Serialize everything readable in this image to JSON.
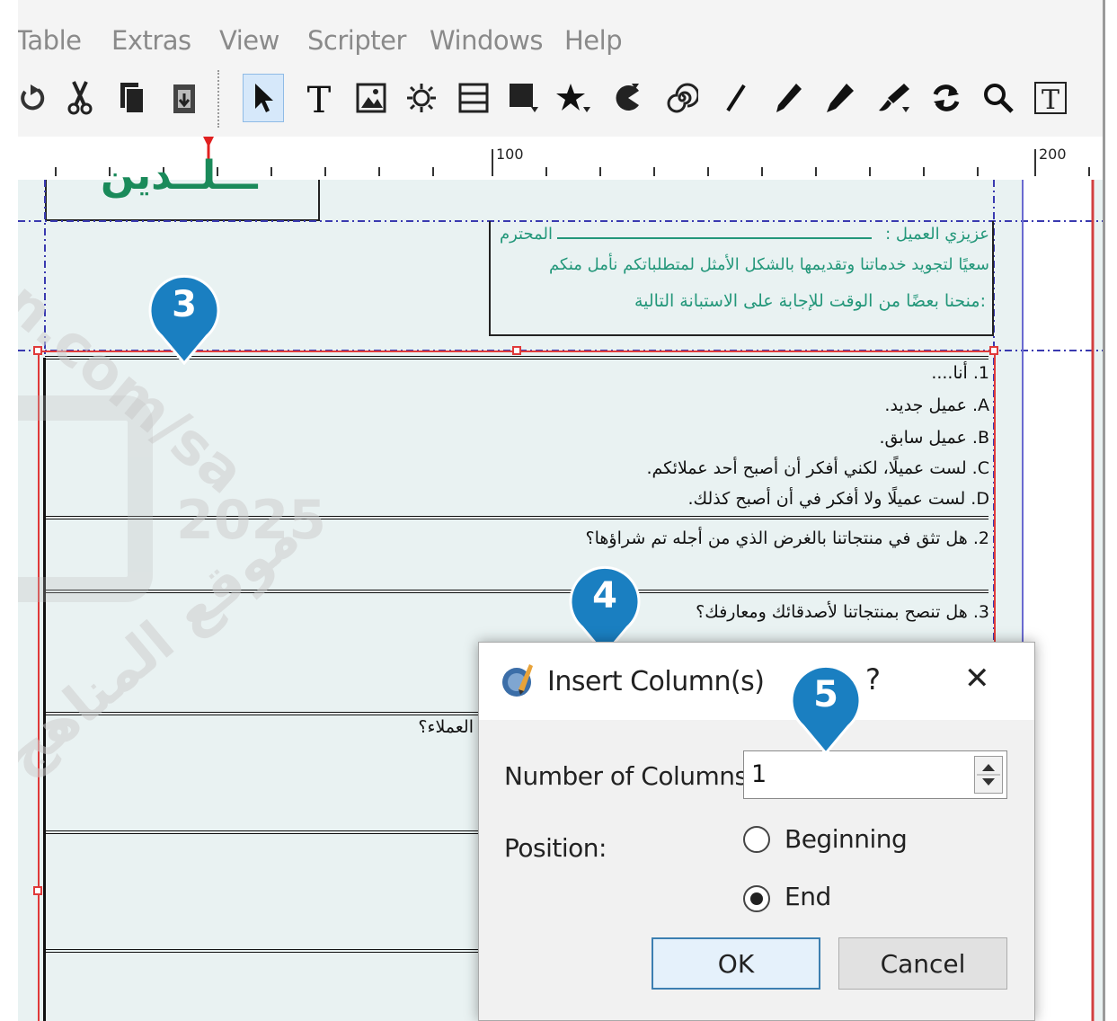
{
  "menu": [
    "Table",
    "Extras",
    "View",
    "Scripter",
    "Windows",
    "Help"
  ],
  "toolbar_icons": [
    "undo-icon",
    "cut-icon",
    "copy-icon",
    "paste-icon",
    "select-icon",
    "text-frame-icon",
    "image-frame-icon",
    "render-frame-icon",
    "table-icon",
    "shape-icon",
    "polygon-icon",
    "arc-icon",
    "spiral-icon",
    "line-icon",
    "bezier-icon",
    "freehand-icon",
    "calligraphic-icon",
    "rotate-icon",
    "zoom-icon",
    "edit-text-icon"
  ],
  "ruler": {
    "marks": [
      "100",
      "200"
    ]
  },
  "document": {
    "header_fragment": "ـــلــدين",
    "greeting": {
      "line1_left": "المحترم",
      "line1_right": "عزيزي العميل :",
      "line2": "سعيًا لتجويد خدماتنا وتقديمها بالشكل الأمثل لمتطلباتكم نأمل منكم",
      "line3": ":منحنا بعضًا من الوقت للإجابة على الاستبانة التالية"
    },
    "questions": [
      {
        "text": "1. أنا....",
        "options": [
          "A. عميل جديد.",
          "B. عميل سابق.",
          "C. لست عميلًا، لكني أفكر أن أصبح أحد عملائكم.",
          "D. لست عميلًا ولا أفكر في أن أصبح كذلك."
        ]
      },
      {
        "text": "2. هل تثق في منتجاتنا بالغرض الذي من أجله تم شراؤها؟"
      },
      {
        "text": "3. هل تنصح بمنتجاتنا لأصدقائك ومعارفك؟"
      },
      {
        "text": "العملاء؟"
      }
    ]
  },
  "callouts": [
    "3",
    "4",
    "5"
  ],
  "dialog": {
    "title": "Insert Column(s)",
    "help": "?",
    "close": "✕",
    "number_label": "Number of Columns:",
    "number_value": "1",
    "position_label": "Position:",
    "options": [
      "Beginning",
      "End"
    ],
    "selected": "End",
    "ok": "OK",
    "cancel": "Cancel"
  },
  "watermark": {
    "url": "n.com/sa",
    "year": "2025",
    "site": "موقع المناهج"
  },
  "colors": {
    "accent_teal": "#23977a",
    "callout_blue": "#1a7fc1",
    "frame_red": "#e03a3a",
    "guide_blue": "#3a3ab0"
  }
}
